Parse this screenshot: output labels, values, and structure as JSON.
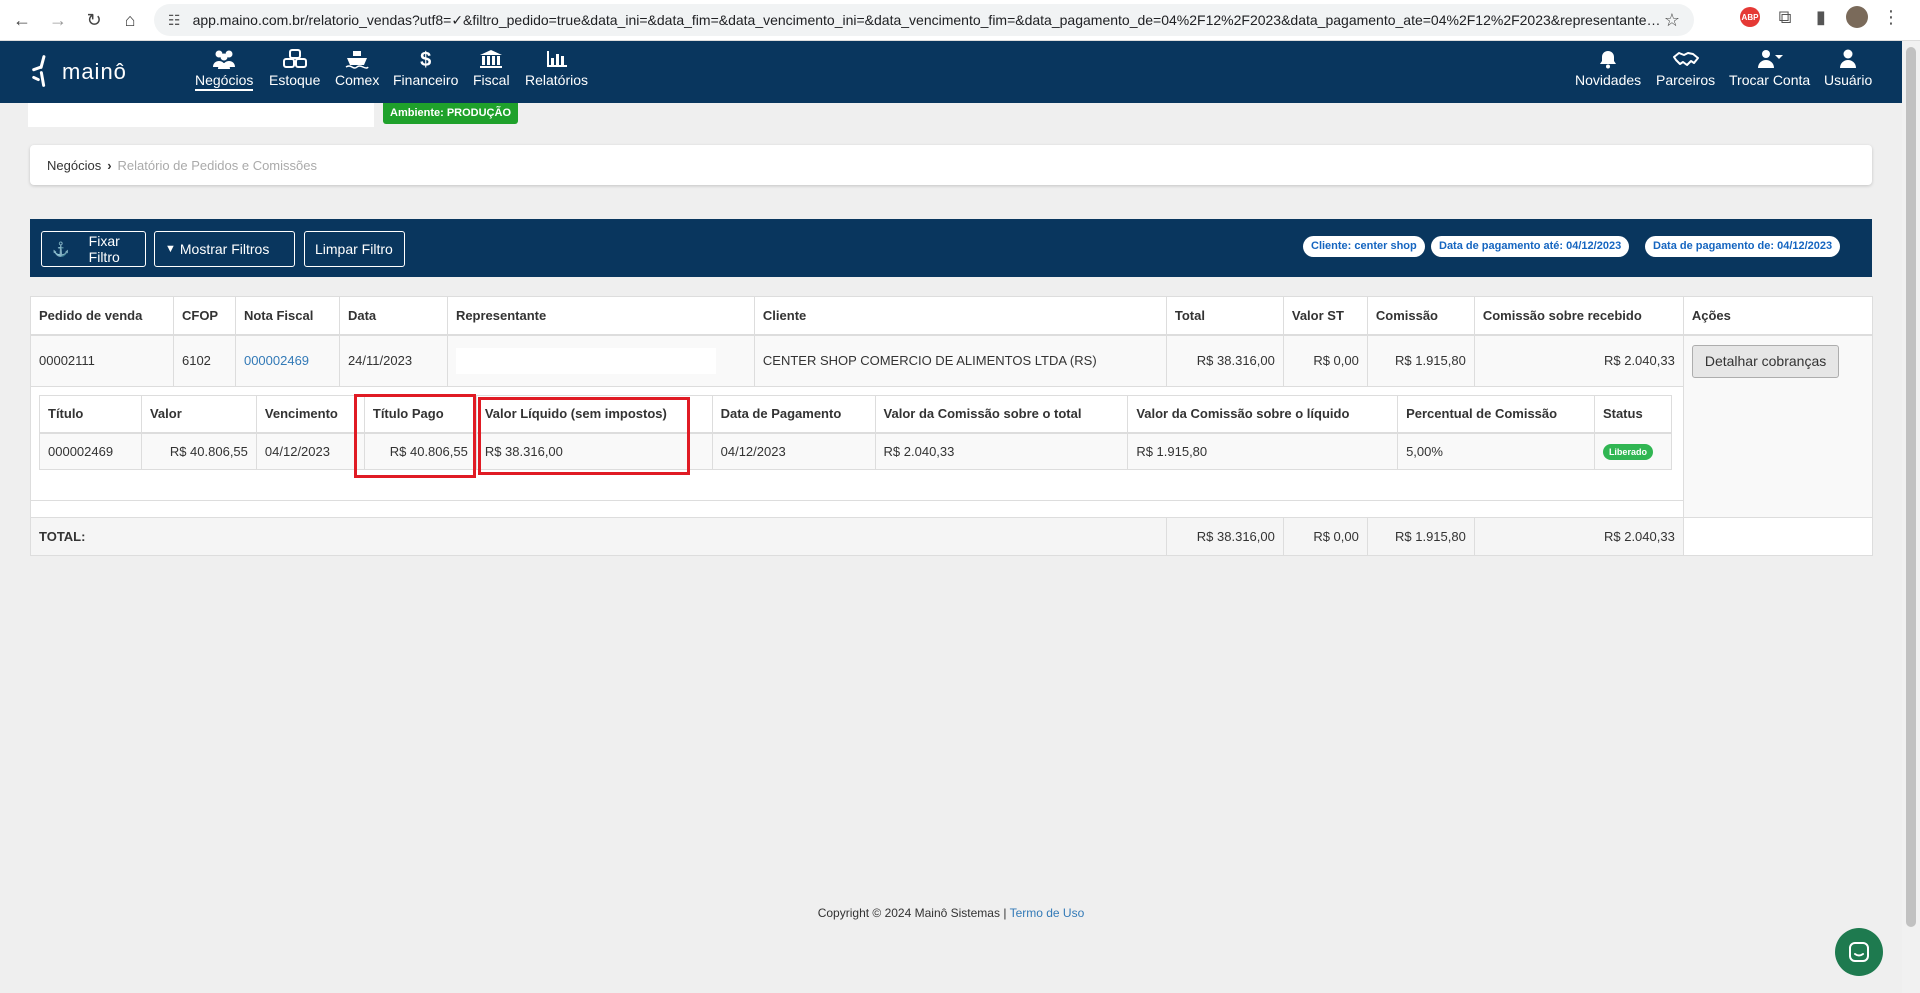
{
  "browser": {
    "url": "app.maino.com.br/relatorio_vendas?utf8=✓&filtro_pedido=true&data_ini=&data_fim=&data_vencimento_ini=&data_vencimento_fim=&data_pagamento_de=04%2F12%2F2023&data_pagamento_ate=04%2F12%2F2023&representante=...",
    "abp_label": "ABP"
  },
  "header": {
    "logo_text": "mainô",
    "nav": [
      {
        "label": "Negócios",
        "icon": "users-icon"
      },
      {
        "label": "Estoque",
        "icon": "boxes-icon"
      },
      {
        "label": "Comex",
        "icon": "ship-icon"
      },
      {
        "label": "Financeiro",
        "icon": "dollar-icon"
      },
      {
        "label": "Fiscal",
        "icon": "bank-icon"
      },
      {
        "label": "Relatórios",
        "icon": "bar-chart-icon"
      }
    ],
    "right_nav": [
      {
        "label": "Novidades",
        "icon": "bell-icon"
      },
      {
        "label": "Parceiros",
        "icon": "handshake-icon"
      },
      {
        "label": "Trocar Conta",
        "icon": "user-switch-icon"
      },
      {
        "label": "Usuário",
        "icon": "user-icon"
      }
    ]
  },
  "environment_badge": "Ambiente: PRODUÇÃO",
  "breadcrumb": {
    "root": "Negócios",
    "current": "Relatório de Pedidos e Comissões"
  },
  "filters": {
    "fix_label": "Fixar Filtro",
    "show_label": "Mostrar Filtros",
    "clear_label": "Limpar Filtro",
    "chips": [
      "Cliente: center shop",
      "Data de pagamento até: 04/12/2023",
      "Data de pagamento de: 04/12/2023"
    ]
  },
  "table": {
    "headers": [
      "Pedido de venda",
      "CFOP",
      "Nota Fiscal",
      "Data",
      "Representante",
      "Cliente",
      "Total",
      "Valor ST",
      "Comissão",
      "Comissão sobre recebido",
      "Ações"
    ],
    "order": {
      "pedido": "00002111",
      "cfop": "6102",
      "nota_fiscal": "000002469",
      "data": "24/11/2023",
      "representante": "",
      "cliente": "CENTER SHOP COMERCIO DE ALIMENTOS LTDA (RS)",
      "total": "R$ 38.316,00",
      "valor_st": "R$ 0,00",
      "comissao": "R$ 1.915,80",
      "comissao_recebido": "R$ 2.040,33",
      "action_label": "Detalhar cobranças"
    },
    "sub_headers": [
      "Título",
      "Valor",
      "Vencimento",
      "Título Pago",
      "Valor Líquido (sem impostos)",
      "Data de Pagamento",
      "Valor da Comissão sobre o total",
      "Valor da Comissão sobre o líquido",
      "Percentual de Comissão",
      "Status"
    ],
    "sub_row": {
      "titulo": "000002469",
      "valor": "R$ 40.806,55",
      "vencimento": "04/12/2023",
      "titulo_pago": "R$ 40.806,55",
      "valor_liquido": "R$ 38.316,00",
      "data_pagamento": "04/12/2023",
      "comissao_total": "R$ 2.040,33",
      "comissao_liquido": "R$ 1.915,80",
      "percentual": "5,00%",
      "status": "Liberado"
    },
    "totals": {
      "label": "TOTAL:",
      "total": "R$ 38.316,00",
      "valor_st": "R$ 0,00",
      "comissao": "R$ 1.915,80",
      "comissao_recebido": "R$ 2.040,33"
    }
  },
  "footer": {
    "copyright": "Copyright © 2024 Mainô Sistemas |",
    "terms_label": "Termo de Uso"
  },
  "colors": {
    "header_bg": "#09365e",
    "accent_link": "#337ab7",
    "env_badge": "#1fa12b",
    "status_green": "#31b653",
    "highlight_red": "#e01b24"
  }
}
